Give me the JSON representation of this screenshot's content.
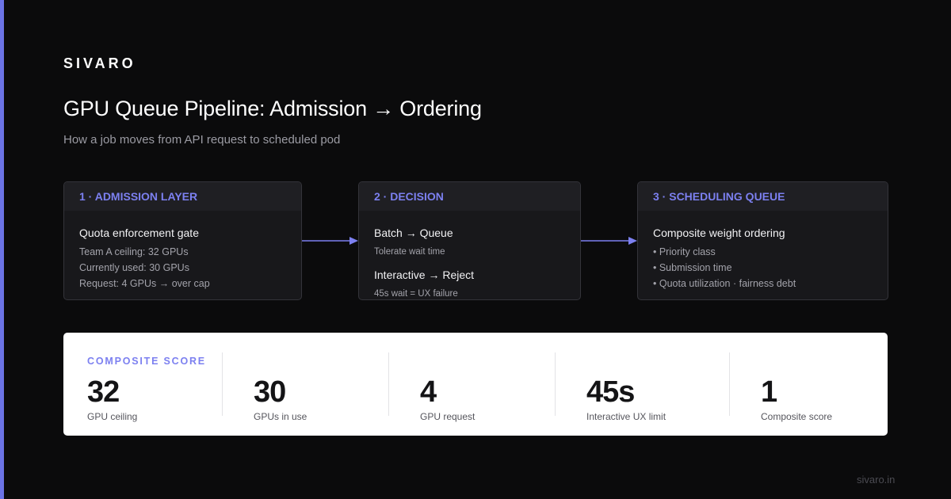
{
  "brand": "SIVARO",
  "title": "GPU Queue Pipeline: Admission → Ordering",
  "subtitle": "How a job moves from API request to scheduled pod",
  "cards": [
    {
      "header": "1 · ADMISSION LAYER",
      "main": "Quota enforcement gate",
      "lines": [
        "Team A ceiling: 32 GPUs",
        "Currently used: 30 GPUs",
        "Request: 4 GPUs → over cap"
      ]
    },
    {
      "header": "2 · DECISION",
      "batch": "Batch → Queue",
      "batch_note": "Tolerate wait time",
      "interactive": "Interactive → Reject",
      "interactive_note": "45s wait = UX failure"
    },
    {
      "header": "3 · SCHEDULING QUEUE",
      "main": "Composite weight ordering",
      "bullets": [
        "• Priority class",
        "• Submission time",
        "• Quota utilization · fairness debt"
      ]
    }
  ],
  "stats": {
    "label": "COMPOSITE SCORE",
    "items": [
      {
        "value": "32",
        "caption": "GPU ceiling"
      },
      {
        "value": "30",
        "caption": "GPUs in use"
      },
      {
        "value": "4",
        "caption": "GPU request"
      },
      {
        "value": "45s",
        "caption": "Interactive UX limit"
      },
      {
        "value": "1",
        "caption": "Composite score"
      }
    ]
  },
  "footer": "sivaro.in",
  "colors": {
    "background": "#0b0b0c",
    "accent": "#6b73e6",
    "card": "#18181b",
    "stats_panel": "#ffffff"
  }
}
